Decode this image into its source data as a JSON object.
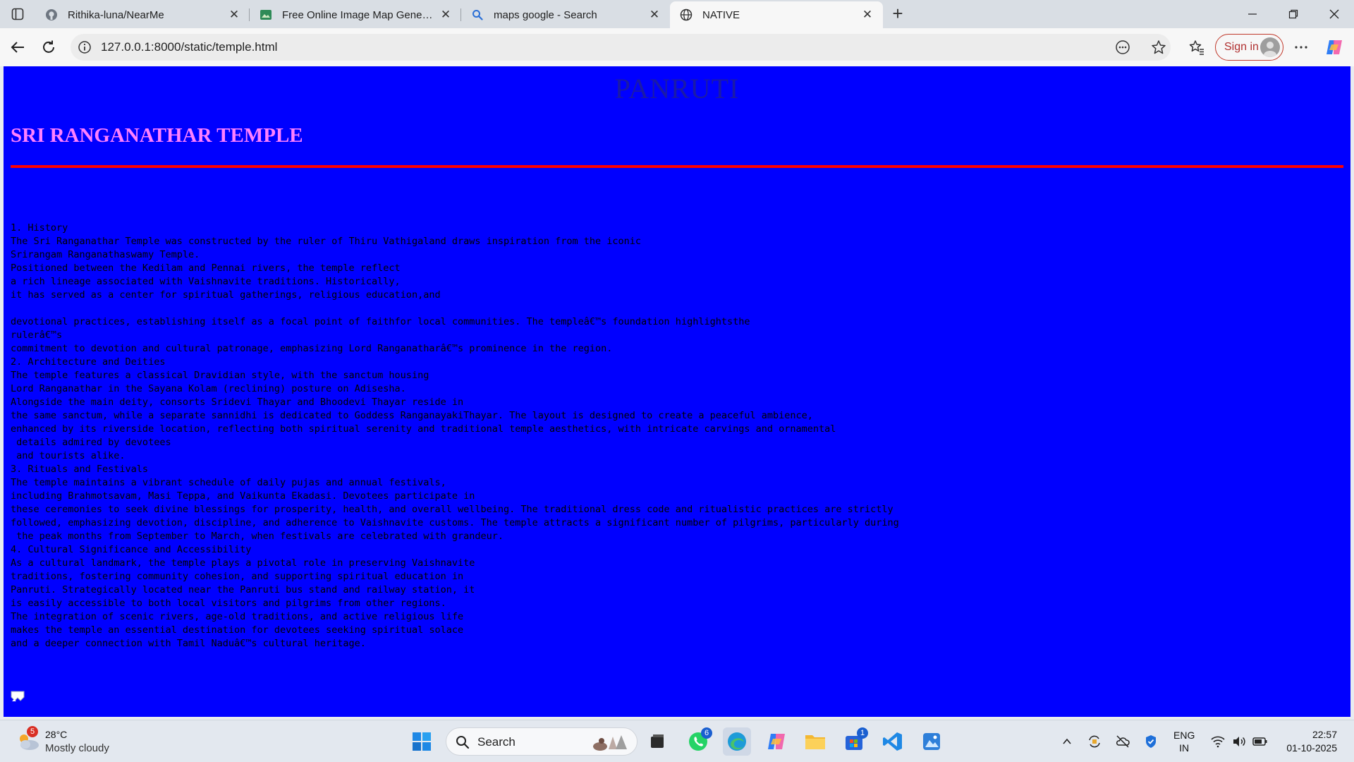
{
  "browser": {
    "tabs": [
      {
        "title": "Rithika-luna/NearMe",
        "icon": "github-icon"
      },
      {
        "title": "Free Online Image Map Generator",
        "icon": "image-map-icon"
      },
      {
        "title": "maps google - Search",
        "icon": "search-icon"
      },
      {
        "title": "NATIVE",
        "icon": "globe-icon",
        "active": true
      }
    ],
    "url": "127.0.0.1:8000/static/temple.html",
    "signin_label": "Sign in"
  },
  "page": {
    "heading": "PANRUTI",
    "title": "SRI RANGANATHAR TEMPLE",
    "background": "#0000ff",
    "lines": [
      "1. History",
      "The Sri Ranganathar Temple was constructed by the ruler of Thiru Vathigaland draws inspiration from the iconic",
      "Srirangam Ranganathaswamy Temple.",
      "Positioned between the Kedilam and Pennai rivers, the temple reflect",
      "a rich lineage associated with Vaishnavite traditions. Historically,",
      "it has served as a center for spiritual gatherings, religious education,and",
      "",
      "devotional practices, establishing itself as a focal point of faithfor local communities. The templeâ€™s foundation highlightsthe",
      "rulerâ€™s",
      "commitment to devotion and cultural patronage, emphasizing Lord Ranganatharâ€™s prominence in the region.",
      "2. Architecture and Deities",
      "The temple features a classical Dravidian style, with the sanctum housing",
      "Lord Ranganathar in the Sayana Kolam (reclining) posture on Adisesha.",
      "Alongside the main deity, consorts Sridevi Thayar and Bhoodevi Thayar reside in",
      "the same sanctum, while a separate sannidhi is dedicated to Goddess RanganayakiThayar. The layout is designed to create a peaceful ambience,",
      "enhanced by its riverside location, reflecting both spiritual serenity and traditional temple aesthetics, with intricate carvings and ornamental",
      " details admired by devotees",
      " and tourists alike.",
      "3. Rituals and Festivals",
      "The temple maintains a vibrant schedule of daily pujas and annual festivals,",
      "including Brahmotsavam, Masi Teppa, and Vaikunta Ekadasi. Devotees participate in",
      "these ceremonies to seek divine blessings for prosperity, health, and overall wellbeing. The traditional dress code and ritualistic practices are strictly",
      "followed, emphasizing devotion, discipline, and adherence to Vaishnavite customs. The temple attracts a significant number of pilgrims, particularly during",
      " the peak months from September to March, when festivals are celebrated with grandeur.",
      "4. Cultural Significance and Accessibility",
      "As a cultural landmark, the temple plays a pivotal role in preserving Vaishnavite",
      "traditions, fostering community cohesion, and supporting spiritual education in",
      "Panruti. Strategically located near the Panruti bus stand and railway station, it",
      "is easily accessible to both local visitors and pilgrims from other regions.",
      "The integration of scenic rivers, age-old traditions, and active religious life",
      "makes the temple an essential destination for devotees seeking spiritual solace",
      "and a deeper connection with Tamil Naduâ€™s cultural heritage."
    ]
  },
  "taskbar": {
    "weather_badge": "5",
    "temperature": "28°C",
    "condition": "Mostly cloudy",
    "search_label": "Search",
    "whatsapp_badge": "6",
    "store_badge": "1",
    "lang_top": "ENG",
    "lang_bottom": "IN",
    "time": "22:57",
    "date": "01-10-2025"
  }
}
